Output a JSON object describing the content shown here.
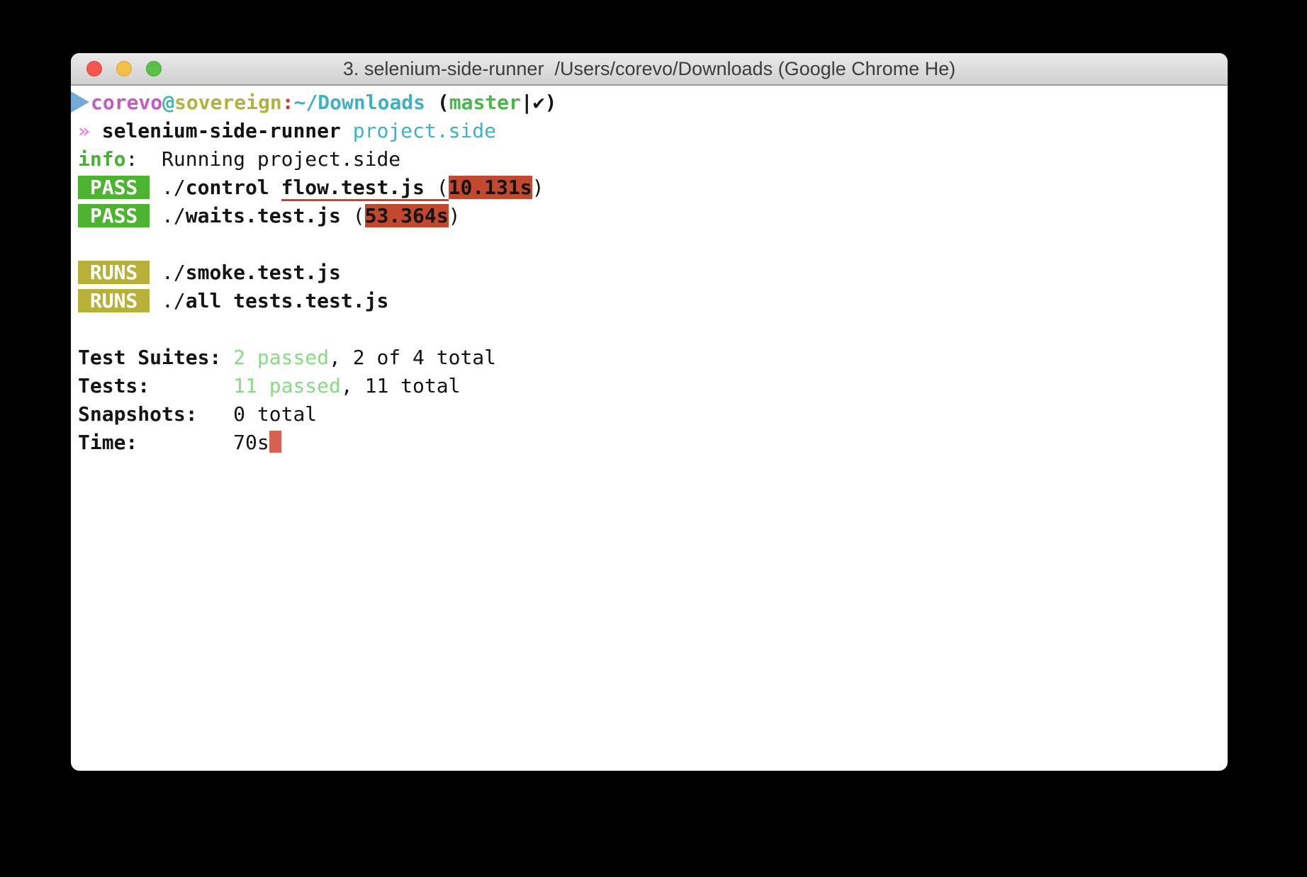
{
  "window": {
    "title": "3. selenium-side-runner  /Users/corevo/Downloads (Google Chrome He)",
    "traffic_lights": [
      "close",
      "minimize",
      "zoom"
    ]
  },
  "palette": {
    "close_red": "#f2564d",
    "minimize_yellow": "#f3bf4b",
    "zoom_green": "#5ac146",
    "text_black": "#141414",
    "prompt_arrow_blue": "#74a9d8",
    "prompt_user_magenta": "#c35bc3",
    "prompt_at_teal": "#3fb5ae",
    "prompt_host_olive": "#b2b23e",
    "prompt_colon_red": "#cb392a",
    "prompt_path_cyan": "#3fb0c6",
    "prompt_branch_green": "#46b946",
    "command_arrow_pink": "#ee82ee",
    "info_green": "#44b42c",
    "pass_badge_green": "#4cb431",
    "runs_badge_olive": "#b7b13a",
    "time_highlight_red": "#c0492f",
    "passed_light_green": "#85dc82",
    "cursor_red": "#d95f52"
  },
  "terminal": {
    "lines": [
      {
        "segments": [
          {
            "t": "",
            "s": "arrow",
            "n": "prompt-arrow-icon"
          },
          {
            "t": "corevo",
            "s": "magenta",
            "n": "prompt-username"
          },
          {
            "t": "@",
            "s": "at",
            "n": "prompt-at"
          },
          {
            "t": "sovereign",
            "s": "olive",
            "n": "prompt-hostname"
          },
          {
            "t": ":",
            "s": "colon",
            "n": "prompt-colon"
          },
          {
            "t": "~/Downloads",
            "s": "path",
            "n": "prompt-path"
          },
          {
            "t": " (",
            "s": "bold",
            "n": "prompt-paren"
          },
          {
            "t": "master",
            "s": "branch",
            "n": "git-branch"
          },
          {
            "t": "|✔)",
            "s": "bold",
            "n": "git-status-check"
          }
        ]
      },
      {
        "segments": [
          {
            "t": "»",
            "s": "pink",
            "n": "command-prompt-chevron"
          },
          {
            "t": " ",
            "s": "plain"
          },
          {
            "t": "selenium-side-runner",
            "s": "bold",
            "n": "command-name"
          },
          {
            "t": " ",
            "s": "plain"
          },
          {
            "t": "project.side",
            "s": "cyan-arg",
            "n": "command-argument"
          }
        ]
      },
      {
        "segments": [
          {
            "t": "info",
            "s": "info-green",
            "n": "log-level"
          },
          {
            "t": ":",
            "s": "plain"
          },
          {
            "t": "  Running project.side",
            "s": "plain",
            "n": "log-message"
          }
        ]
      },
      {
        "segments": [
          {
            "t": " PASS ",
            "s": "badge-pass",
            "n": "pass-badge"
          },
          {
            "t": " ",
            "s": "plain"
          },
          {
            "t": "./",
            "s": "plain"
          },
          {
            "t": "control ",
            "s": "bold",
            "n": "test-file-name"
          },
          {
            "t": "flow.test.js",
            "s": "bold-redline",
            "n": "test-file-name"
          },
          {
            "t": " (",
            "s": "plain-redline"
          },
          {
            "t": "10.131s",
            "s": "hl-red",
            "n": "test-duration"
          },
          {
            "t": ")",
            "s": "plain"
          }
        ]
      },
      {
        "segments": [
          {
            "t": " PASS ",
            "s": "badge-pass",
            "n": "pass-badge"
          },
          {
            "t": " ",
            "s": "plain"
          },
          {
            "t": "./",
            "s": "plain"
          },
          {
            "t": "waits.test.js",
            "s": "bold",
            "n": "test-file-name"
          },
          {
            "t": " (",
            "s": "plain"
          },
          {
            "t": "53.364s",
            "s": "hl-red",
            "n": "test-duration"
          },
          {
            "t": ")",
            "s": "plain"
          }
        ]
      },
      {
        "segments": []
      },
      {
        "segments": [
          {
            "t": " RUNS ",
            "s": "badge-runs",
            "n": "runs-badge"
          },
          {
            "t": " ",
            "s": "plain"
          },
          {
            "t": "./",
            "s": "plain"
          },
          {
            "t": "smoke.test.js",
            "s": "bold",
            "n": "test-file-name"
          }
        ]
      },
      {
        "segments": [
          {
            "t": " RUNS ",
            "s": "badge-runs",
            "n": "runs-badge"
          },
          {
            "t": " ",
            "s": "plain"
          },
          {
            "t": "./",
            "s": "plain"
          },
          {
            "t": "all tests.test.js",
            "s": "bold",
            "n": "test-file-name"
          }
        ]
      },
      {
        "segments": []
      },
      {
        "segments": [
          {
            "t": "Test Suites: ",
            "s": "bold",
            "n": "summary-label"
          },
          {
            "t": "2 passed",
            "s": "lightgreen",
            "n": "summary-passed-count"
          },
          {
            "t": ", 2 of 4 total",
            "s": "plain",
            "n": "summary-total"
          }
        ]
      },
      {
        "segments": [
          {
            "t": "Tests:       ",
            "s": "bold",
            "n": "summary-label"
          },
          {
            "t": "11 passed",
            "s": "lightgreen",
            "n": "summary-passed-count"
          },
          {
            "t": ", 11 total",
            "s": "plain",
            "n": "summary-total"
          }
        ]
      },
      {
        "segments": [
          {
            "t": "Snapshots:   ",
            "s": "bold",
            "n": "summary-label"
          },
          {
            "t": "0 total",
            "s": "plain",
            "n": "summary-total"
          }
        ]
      },
      {
        "segments": [
          {
            "t": "Time:        ",
            "s": "bold",
            "n": "summary-label"
          },
          {
            "t": "70s",
            "s": "plain",
            "n": "summary-time-value"
          },
          {
            "t": "",
            "s": "cursor",
            "n": "terminal-cursor"
          }
        ]
      }
    ]
  }
}
